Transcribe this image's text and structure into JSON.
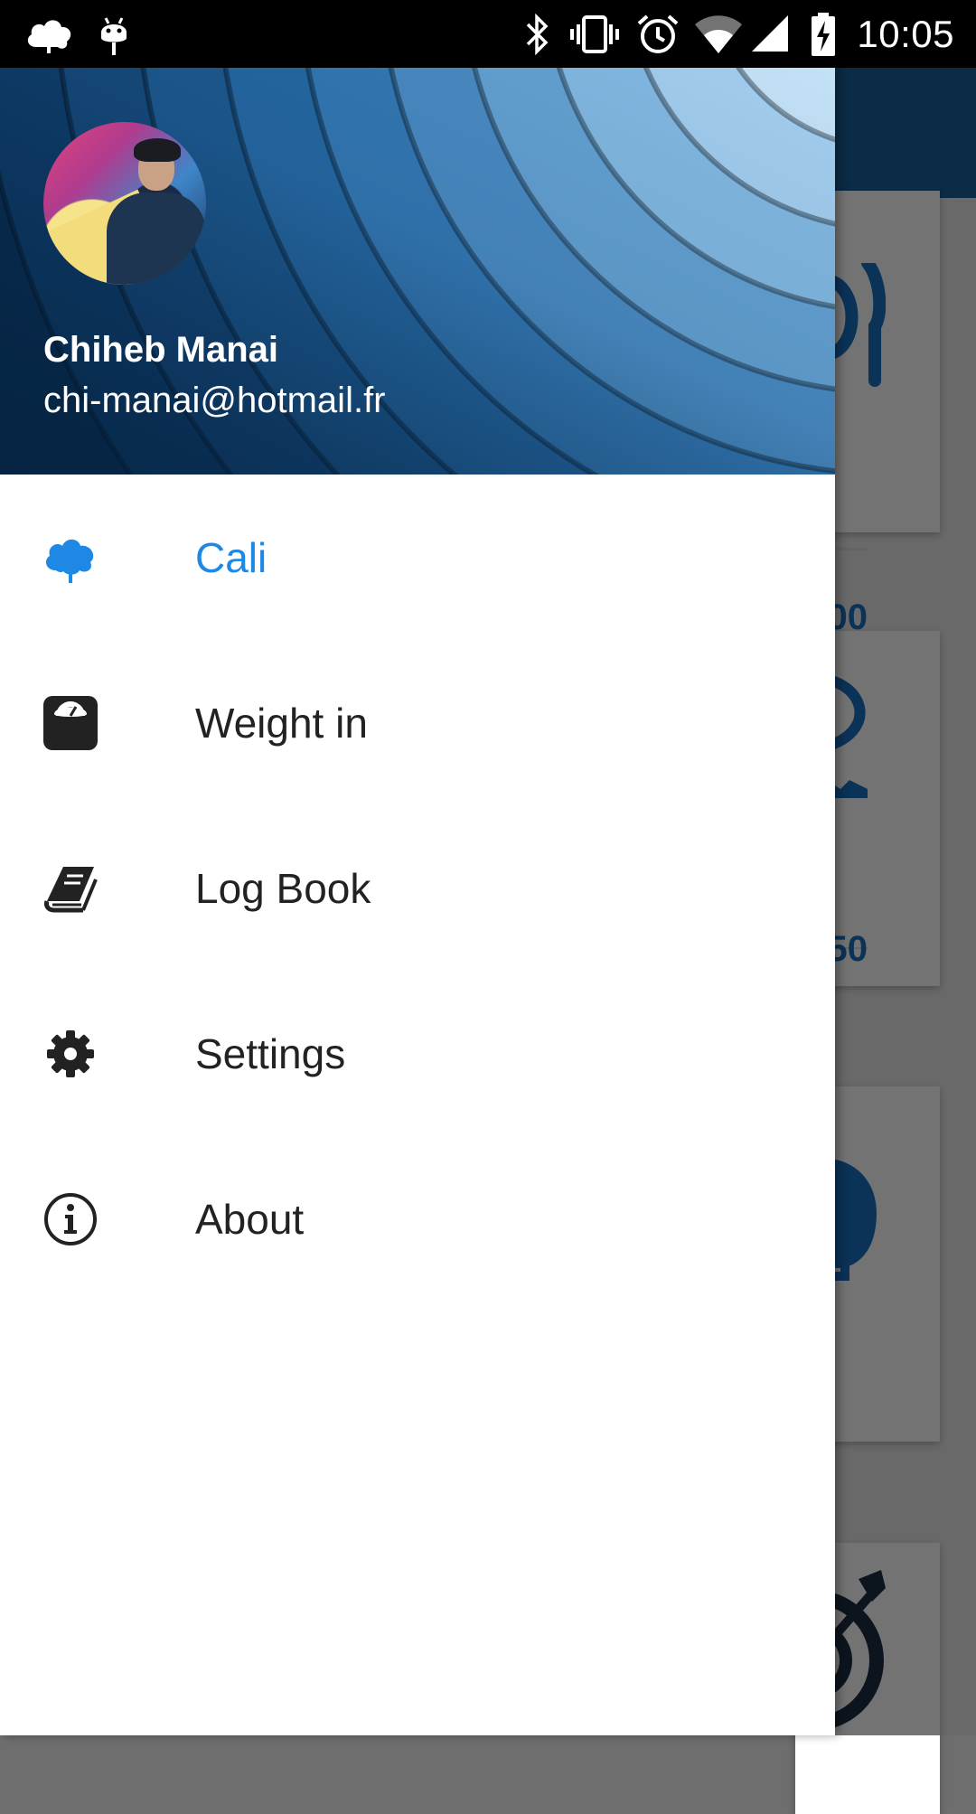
{
  "status_bar": {
    "time": "10:05",
    "left_icons": [
      "cloud-notification-icon",
      "android-debug-icon"
    ],
    "right_icons": [
      "bluetooth-icon",
      "vibrate-icon",
      "alarm-icon",
      "wifi-icon",
      "cellular-signal-icon",
      "battery-charging-icon"
    ]
  },
  "drawer": {
    "header": {
      "name": "Chiheb Manai",
      "email": "chi-manai@hotmail.fr"
    },
    "menu": [
      {
        "label": "Cali",
        "icon": "tree-icon",
        "active": true
      },
      {
        "label": "Weight in",
        "icon": "scale-icon",
        "active": false
      },
      {
        "label": "Log Book",
        "icon": "book-icon",
        "active": false
      },
      {
        "label": "Settings",
        "icon": "gear-icon",
        "active": false
      },
      {
        "label": "About",
        "icon": "info-icon",
        "active": false
      }
    ]
  },
  "background_app": {
    "cards": [
      {
        "value_fragment": "00",
        "icon": "fork-knife-icon"
      },
      {
        "value_fragment": "50",
        "icon": "running-shoe-icon"
      },
      {
        "icon": "apple-scale-icon"
      },
      {
        "icon": "target-icon"
      }
    ]
  },
  "colors": {
    "accent": "#1e88e5",
    "header_dark": "#0d3a63",
    "status_bar": "#000000",
    "scrim": "rgba(0,0,0,0.55)"
  }
}
